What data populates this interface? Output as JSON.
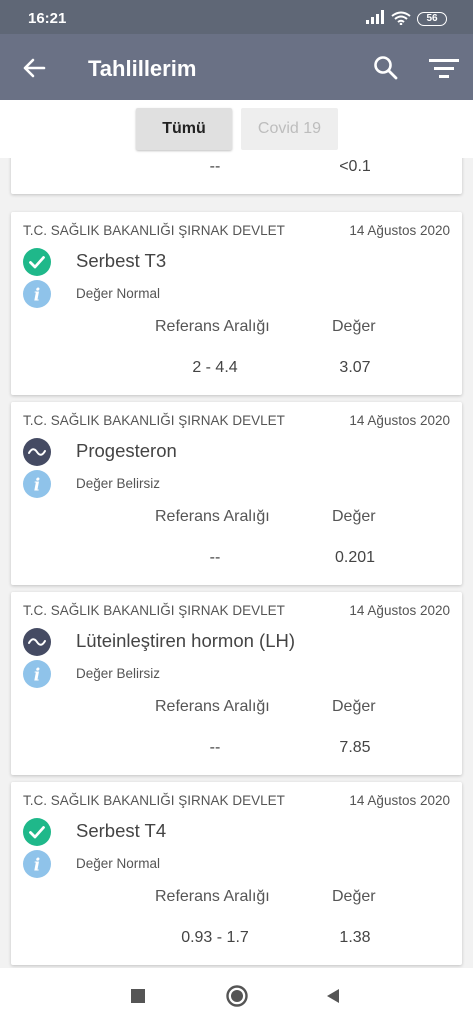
{
  "status_bar": {
    "time": "16:21",
    "battery": "56"
  },
  "app_bar": {
    "title": "Tahlillerim",
    "icons": [
      "back-arrow-icon",
      "search-icon",
      "filter-icon"
    ]
  },
  "tabs": [
    {
      "label": "Tümü",
      "active": true
    },
    {
      "label": "Covid 19",
      "active": false
    }
  ],
  "partial_card": {
    "reference": "--",
    "value": "<0.1"
  },
  "cards": [
    {
      "institution": "T.C. SAĞLIK BAKANLIĞI ŞIRNAK DEVLET",
      "date": "14 Ağustos 2020",
      "test": "Serbest T3",
      "status": "normal",
      "note": "Değer Normal",
      "reference_header": "Referans Aralığı",
      "value_header": "Değer",
      "reference": "2 - 4.4",
      "value": "3.07"
    },
    {
      "institution": "T.C. SAĞLIK BAKANLIĞI ŞIRNAK DEVLET",
      "date": "14 Ağustos 2020",
      "test": "Progesteron",
      "status": "uncertain",
      "note": "Değer Belirsiz",
      "reference_header": "Referans Aralığı",
      "value_header": "Değer",
      "reference": "--",
      "value": "0.201"
    },
    {
      "institution": "T.C. SAĞLIK BAKANLIĞI ŞIRNAK DEVLET",
      "date": "14 Ağustos 2020",
      "test": "Lüteinleştiren hormon (LH)",
      "status": "uncertain",
      "note": "Değer Belirsiz",
      "reference_header": "Referans Aralığı",
      "value_header": "Değer",
      "reference": "--",
      "value": "7.85"
    },
    {
      "institution": "T.C. SAĞLIK BAKANLIĞI ŞIRNAK DEVLET",
      "date": "14 Ağustos 2020",
      "test": "Serbest T4",
      "status": "normal",
      "note": "Değer Normal",
      "reference_header": "Referans Aralığı",
      "value_header": "Değer",
      "reference": "0.93 - 1.7",
      "value": "1.38"
    }
  ],
  "colors": {
    "status_bar": "#5f6776",
    "app_bar": "#6a7185",
    "normal_green": "#1fb88a",
    "uncertain_navy": "#454b63",
    "info_blue": "#8fc3ea"
  },
  "nav_bar_icons": [
    "recents-square-icon",
    "home-circle-icon",
    "back-triangle-icon"
  ]
}
